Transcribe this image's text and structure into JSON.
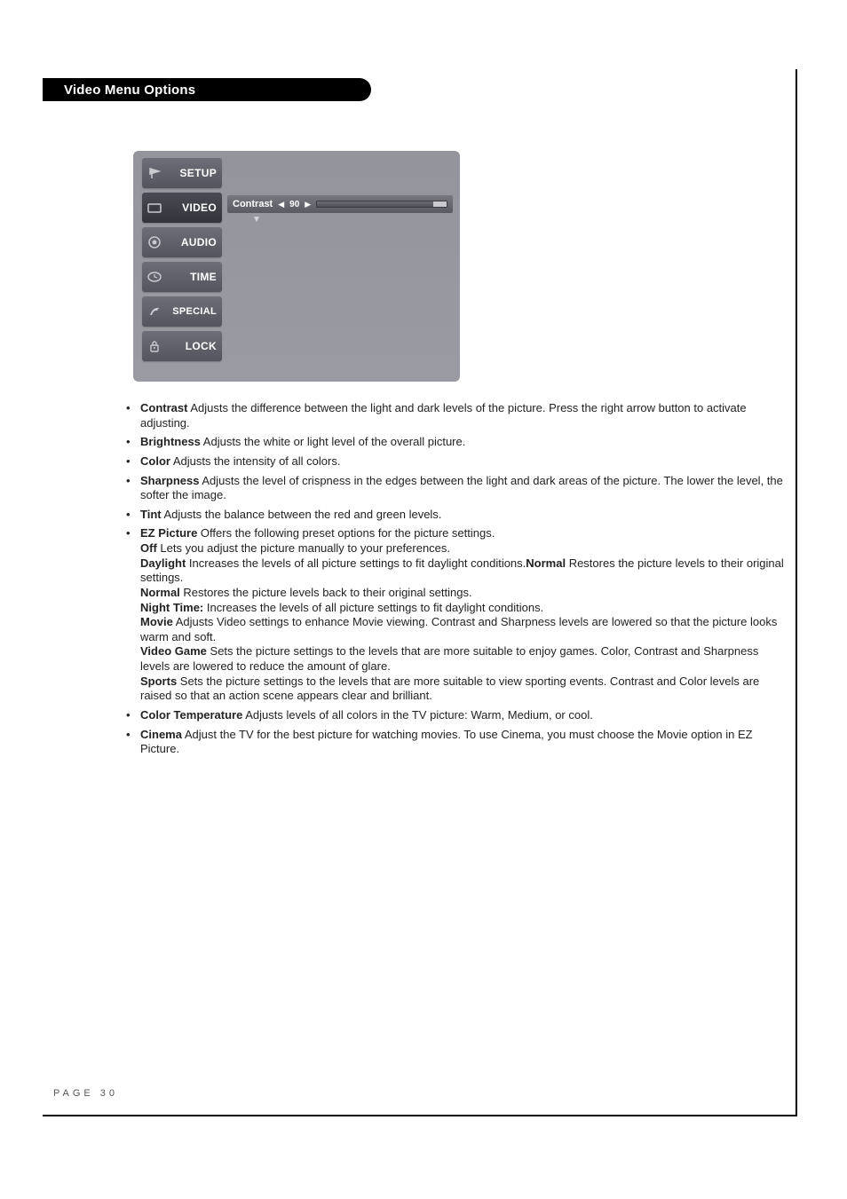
{
  "header": {
    "title": "Video Menu Options"
  },
  "menu": {
    "items": [
      {
        "label": "SETUP",
        "icon": "setup-icon"
      },
      {
        "label": "VIDEO",
        "icon": "video-icon",
        "selected": true
      },
      {
        "label": "AUDIO",
        "icon": "audio-icon"
      },
      {
        "label": "TIME",
        "icon": "time-icon"
      },
      {
        "label": "SPECIAL",
        "icon": "special-icon"
      },
      {
        "label": "LOCK",
        "icon": "lock-icon"
      }
    ],
    "setting": {
      "label": "Contrast",
      "value": "90",
      "fill_percent": 90
    }
  },
  "body": {
    "contrast": {
      "term": "Contrast",
      "text": "  Adjusts the difference between the light and dark levels of the picture. Press the right arrow button to activate adjusting."
    },
    "brightness": {
      "term": "Brightness",
      "text": "  Adjusts the white or light level of the overall picture."
    },
    "color": {
      "term": "Color",
      "text": "  Adjusts the intensity of all colors."
    },
    "sharpness": {
      "term": "Sharpness",
      "text": "  Adjusts the level of crispness in the edges between the light and dark areas of the picture. The lower the level, the softer the image."
    },
    "tint": {
      "term": "Tint",
      "text": "  Adjusts the balance between the red and green levels."
    },
    "ez": {
      "term": "EZ Picture",
      "intro": "  Offers the following preset options for the picture settings.",
      "off_term": "Off",
      "off_text": " Lets you adjust the picture manually to your preferences.",
      "daylight_term": "Daylight",
      "daylight_text": " Increases the levels of all picture settings to fit daylight conditions.",
      "normal_inline_term": "Normal",
      "normal_inline_text": " Restores the picture levels to their original settings.",
      "normal2_term": "Normal",
      "normal2_text": " Restores the picture levels back to their original settings.",
      "night_term": "Night Time:",
      "night_text": " Increases the levels of all picture settings to fit daylight conditions.",
      "movie_term": "Movie",
      "movie_text": " Adjusts Video settings to enhance Movie viewing. Contrast and Sharpness levels are lowered so that the picture looks warm and soft.",
      "game_term": "Video Game",
      "game_text": " Sets the picture settings to the levels that are more suitable to enjoy games. Color, Contrast and Sharpness levels are lowered to reduce the amount of glare.",
      "sports_term": "Sports",
      "sports_text": " Sets the picture settings to the levels that are more suitable to view sporting events. Contrast and Color levels are raised so that an action scene appears clear and brilliant."
    },
    "colortemp": {
      "term": "Color Temperature",
      "text": "  Adjusts levels of all colors in the TV picture: Warm, Medium, or cool."
    },
    "cinema": {
      "term": "Cinema",
      "text": "  Adjust the TV for the best picture for watching movies. To use Cinema, you must choose the Movie option in EZ Picture."
    }
  },
  "footer": {
    "page": "PAGE 30"
  }
}
